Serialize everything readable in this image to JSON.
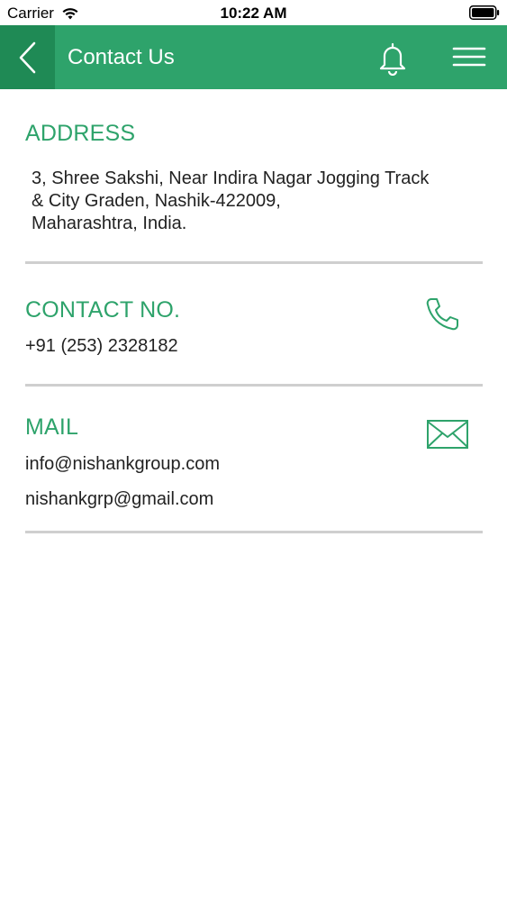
{
  "status_bar": {
    "carrier": "Carrier",
    "time": "10:22 AM"
  },
  "nav": {
    "title": "Contact Us",
    "back_icon": "chevron-left-icon",
    "notification_icon": "bell-icon",
    "menu_icon": "hamburger-menu-icon"
  },
  "address": {
    "heading": "ADDRESS",
    "lines": [
      "3, Shree Sakshi, Near Indira Nagar Jogging Track",
      "& City Graden, Nashik-422009,",
      "Maharashtra, India."
    ]
  },
  "contact": {
    "heading": "CONTACT NO.",
    "phone": "+91 (253) 2328182",
    "icon": "phone-icon"
  },
  "mail": {
    "heading": "MAIL",
    "emails": [
      "info@nishankgroup.com",
      "nishankgrp@gmail.com"
    ],
    "icon": "envelope-icon"
  },
  "colors": {
    "accent": "#2ea36b",
    "accent_dark": "#1f8a55",
    "divider": "#cfcfcf"
  }
}
